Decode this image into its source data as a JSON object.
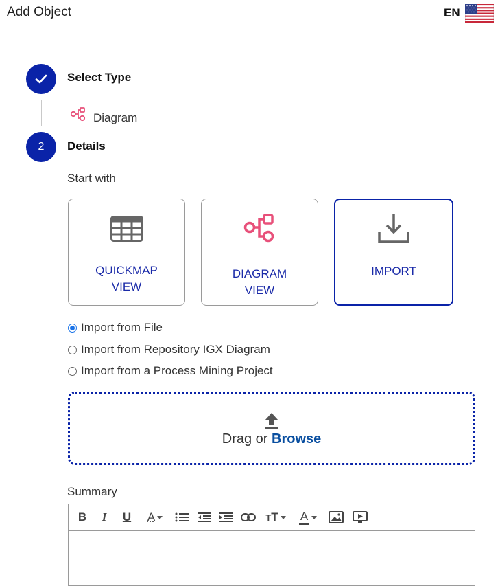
{
  "header": {
    "title": "Add Object",
    "lang": "EN",
    "flag_icon": "us-flag-icon"
  },
  "steps": [
    {
      "number": "",
      "title": "Select Type",
      "status": "completed",
      "selected_type": {
        "icon": "diagram-icon",
        "label": "Diagram"
      }
    },
    {
      "number": "2",
      "title": "Details",
      "status": "active"
    }
  ],
  "start_with": {
    "label": "Start with",
    "cards": [
      {
        "line1": "QUICKMAP",
        "line2": "VIEW",
        "icon": "table-grid-icon",
        "selected": false
      },
      {
        "line1": "DIAGRAM",
        "line2": "VIEW",
        "icon": "diagram-icon",
        "selected": false
      },
      {
        "line1": "IMPORT",
        "line2": "",
        "icon": "download-icon",
        "selected": true
      }
    ]
  },
  "import_options": [
    {
      "label": "Import from File",
      "checked": true
    },
    {
      "label": "Import from Repository IGX Diagram",
      "checked": false
    },
    {
      "label": "Import from a Process Mining Project",
      "checked": false
    }
  ],
  "dropzone": {
    "text": "Drag or ",
    "link": "Browse"
  },
  "summary": {
    "label": "Summary",
    "toolbar": [
      "bold",
      "italic",
      "underline",
      "font-color",
      "bulleted-list",
      "outdent",
      "indent",
      "link",
      "text-size",
      "highlight-color",
      "image",
      "video"
    ]
  },
  "colors": {
    "primary": "#0a23a8",
    "diagram_accent": "#e8507a",
    "link": "#0a4fa0"
  }
}
